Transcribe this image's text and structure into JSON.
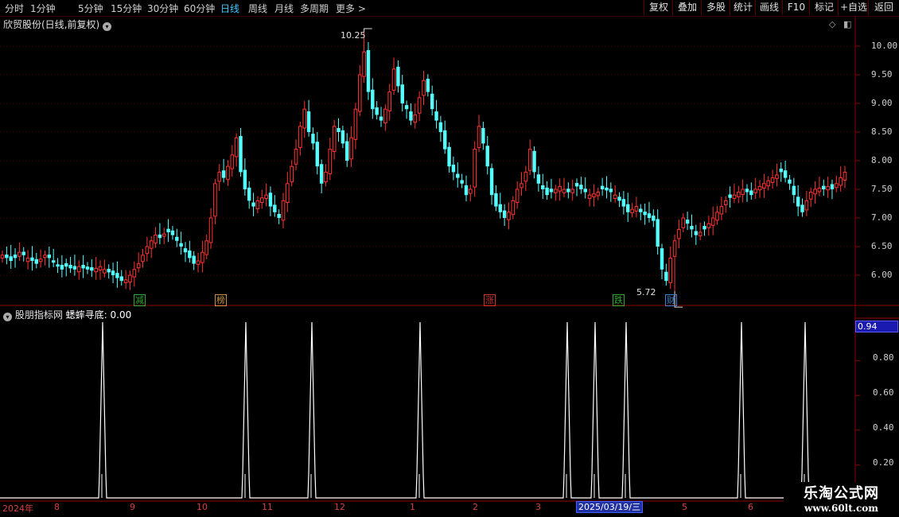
{
  "toolbar": {
    "periods": [
      "分时",
      "1分钟",
      "5分钟",
      "15分钟",
      "30分钟",
      "60分钟",
      "日线",
      "周线",
      "月线",
      "多周期",
      "更多"
    ],
    "active_period": "日线",
    "right_buttons": [
      "复权",
      "叠加",
      "多股",
      "统计",
      "画线",
      "F10",
      "标记",
      "+自选",
      "返回"
    ]
  },
  "main_chart": {
    "title": "欣贸股份(日线,前复权)",
    "high_label": "10.25",
    "low_label": "5.72",
    "price_ticks": [
      "10.00",
      "9.50",
      "9.00",
      "8.50",
      "8.00",
      "7.50",
      "7.00",
      "6.50",
      "6.00"
    ],
    "markers": [
      {
        "text": "减",
        "color": "#2ea82e"
      },
      {
        "text": "榜",
        "color": "#c89040"
      },
      {
        "text": "涨",
        "color": "#c83030"
      },
      {
        "text": "跌",
        "color": "#2ea82e"
      },
      {
        "text": "财",
        "color": "#4080d0"
      }
    ],
    "colors": {
      "up": "#ff3232",
      "down": "#54ffff"
    }
  },
  "indicator": {
    "title": "股朋指标网",
    "name": "蟋蟀寻底:",
    "value": "0.00",
    "current_value": "0.94",
    "ticks": [
      "0.80",
      "0.60",
      "0.40",
      "0.20"
    ]
  },
  "date_axis": {
    "labels": [
      "2024年",
      "8",
      "9",
      "10",
      "11",
      "12",
      "1",
      "2",
      "3",
      "5",
      "6"
    ],
    "cursor_date": "2025/03/19/三"
  },
  "watermark": {
    "line1": "乐淘公式网",
    "line2": "www.60lt.com"
  },
  "chart_data": {
    "type": "candlestick",
    "ylim": [
      5.5,
      10.5
    ],
    "high": 10.25,
    "low": 5.72,
    "closes": [
      6.35,
      6.3,
      6.25,
      6.3,
      6.4,
      6.35,
      6.3,
      6.25,
      6.2,
      6.28,
      6.35,
      6.3,
      6.22,
      6.15,
      6.1,
      6.15,
      6.12,
      6.1,
      6.15,
      6.12,
      6.1,
      6.08,
      6.12,
      6.15,
      6.1,
      6.05,
      6.0,
      5.95,
      5.9,
      5.92,
      6.0,
      6.1,
      6.2,
      6.35,
      6.5,
      6.6,
      6.7,
      6.65,
      6.72,
      6.75,
      6.7,
      6.6,
      6.5,
      6.4,
      6.3,
      6.2,
      6.25,
      6.4,
      6.6,
      7.0,
      7.6,
      7.8,
      7.7,
      7.9,
      8.1,
      8.4,
      7.8,
      7.5,
      7.3,
      7.2,
      7.3,
      7.35,
      7.4,
      7.2,
      7.1,
      7.0,
      7.3,
      7.6,
      7.9,
      8.2,
      8.6,
      8.9,
      8.5,
      8.3,
      7.9,
      7.6,
      7.8,
      8.2,
      8.6,
      8.5,
      8.3,
      8.0,
      8.4,
      8.9,
      9.5,
      9.9,
      9.2,
      8.9,
      8.8,
      8.7,
      8.9,
      9.2,
      9.6,
      9.3,
      9.0,
      8.9,
      8.7,
      8.8,
      9.1,
      9.4,
      9.2,
      8.9,
      8.7,
      8.5,
      8.2,
      7.9,
      7.8,
      7.7,
      7.6,
      7.4,
      7.5,
      8.2,
      8.6,
      8.3,
      7.9,
      7.4,
      7.2,
      7.1,
      7.0,
      7.1,
      7.3,
      7.5,
      7.6,
      7.8,
      8.2,
      7.8,
      7.6,
      7.5,
      7.4,
      7.45,
      7.5,
      7.55,
      7.5,
      7.45,
      7.5,
      7.55,
      7.5,
      7.45,
      7.4,
      7.42,
      7.45,
      7.5,
      7.48,
      7.45,
      7.4,
      7.3,
      7.2,
      7.1,
      7.15,
      7.2,
      7.1,
      7.05,
      7.0,
      6.95,
      6.5,
      6.1,
      5.9,
      6.3,
      6.6,
      6.8,
      7.0,
      6.9,
      6.8,
      6.7,
      6.75,
      6.8,
      6.9,
      7.0,
      7.1,
      7.2,
      7.3,
      7.35,
      7.4,
      7.45,
      7.5,
      7.45,
      7.4,
      7.5,
      7.55,
      7.6,
      7.65,
      7.7,
      7.75,
      7.8,
      7.7,
      7.6,
      7.4,
      7.2,
      7.1,
      7.3,
      7.45,
      7.5,
      7.52,
      7.5,
      7.55,
      7.5,
      7.6,
      7.7,
      7.8
    ],
    "indicator_spikes": [
      129,
      309,
      392,
      528,
      713,
      748,
      787,
      932,
      1012
    ]
  }
}
